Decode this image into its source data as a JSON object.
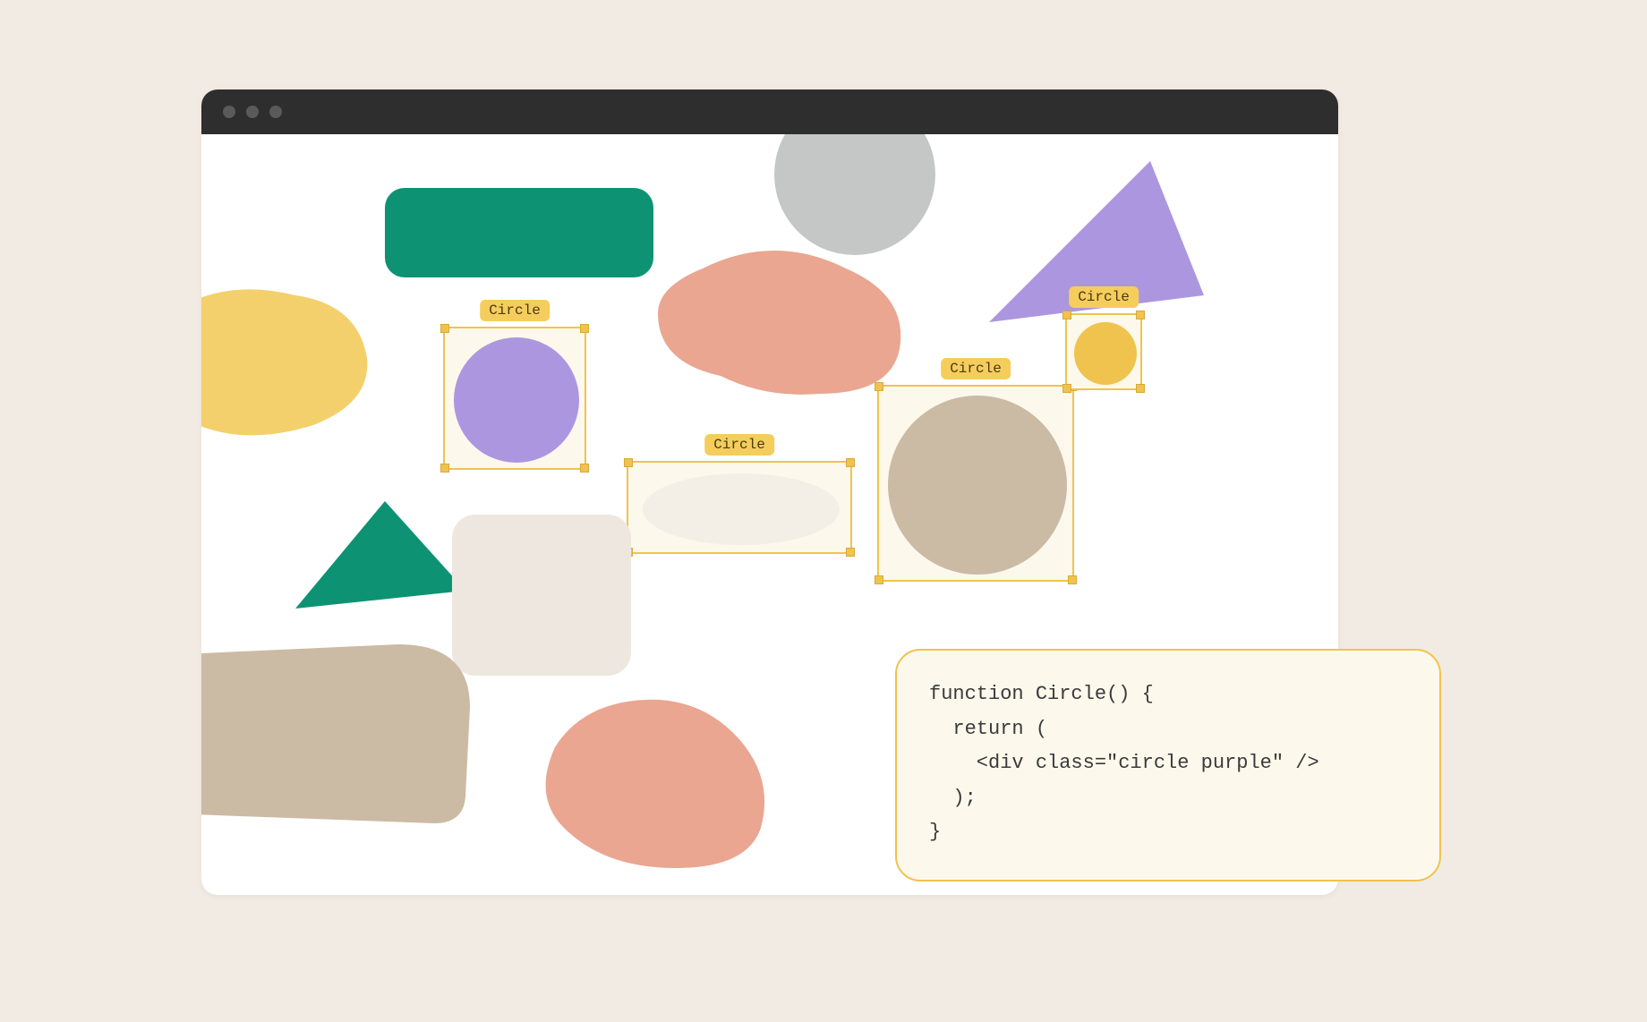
{
  "selections": {
    "purple_circle_label": "Circle",
    "ellipse_label": "Circle",
    "beige_circle_label": "Circle",
    "yellow_circle_label": "Circle"
  },
  "code": {
    "line1": "function Circle() {",
    "line2": "  return (",
    "line3": "    <div class=\"circle purple\" />",
    "line4": "  );",
    "line5": "}"
  },
  "colors": {
    "bg": "#f2ebe3",
    "titlebar": "#2e2e2e",
    "green": "#0d9373",
    "gray": "#c5c7c7",
    "purple": "#ad96e0",
    "yellow": "#f0c34e",
    "peach": "#eaa691",
    "beige": "#cbbba4",
    "cream": "#eee7e0",
    "tag_bg": "#f5cd5d",
    "code_bg": "#fcf8ec"
  }
}
